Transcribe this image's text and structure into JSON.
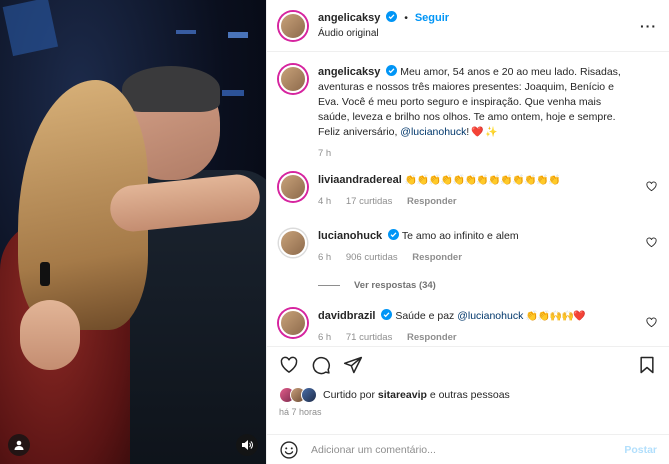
{
  "post": {
    "author": "angelicaksy",
    "follow_label": "Seguir",
    "audio": "Áudio original",
    "caption_text": "Meu amor, 54 anos e 20 ao meu lado. Risadas, aventuras e nossos três maiores presentes: Joaquim, Benício e Eva. Você é meu porto seguro e inspiração. Que venha mais saúde, leveza e brilho nos olhos. Te amo ontem, hoje e sempre. Feliz aniversário, ",
    "caption_mention": "@lucianohuck",
    "caption_emoji": "! ❤️ ✨",
    "caption_time": "7 h"
  },
  "comments": [
    {
      "user": "liviaandradereal",
      "text": "👏👏👏👏👏👏👏👏👏👏👏👏👏",
      "time": "4 h",
      "likes": "17 curtidas",
      "reply": "Responder"
    },
    {
      "user": "lucianohuck",
      "text": "Te amo ao infinito e alem",
      "time": "6 h",
      "likes": "906 curtidas",
      "reply": "Responder"
    },
    {
      "user": "davidbrazil",
      "text": "Saúde e paz ",
      "mention": "@lucianohuck",
      "emoji": " 👏👏🙌🙌❤️",
      "time": "6 h",
      "likes": "71 curtidas",
      "reply": "Responder"
    }
  ],
  "view_replies": "Ver respostas (34)",
  "likes": {
    "prefix": "Curtido por ",
    "user": "sitareavip",
    "suffix": " e outras pessoas"
  },
  "post_time": "há 7 horas",
  "comment_input": {
    "placeholder": "Adicionar um comentário...",
    "post_label": "Postar"
  },
  "colors": {
    "link": "#0095f6",
    "mention": "#00376b",
    "verified": "#0095f6",
    "heart": "#ed4956"
  },
  "icons": [
    "verified-badge-icon",
    "more-icon",
    "heart-icon",
    "comment-icon",
    "share-icon",
    "bookmark-icon",
    "emoji-icon",
    "user-tag-icon",
    "audio-icon"
  ]
}
